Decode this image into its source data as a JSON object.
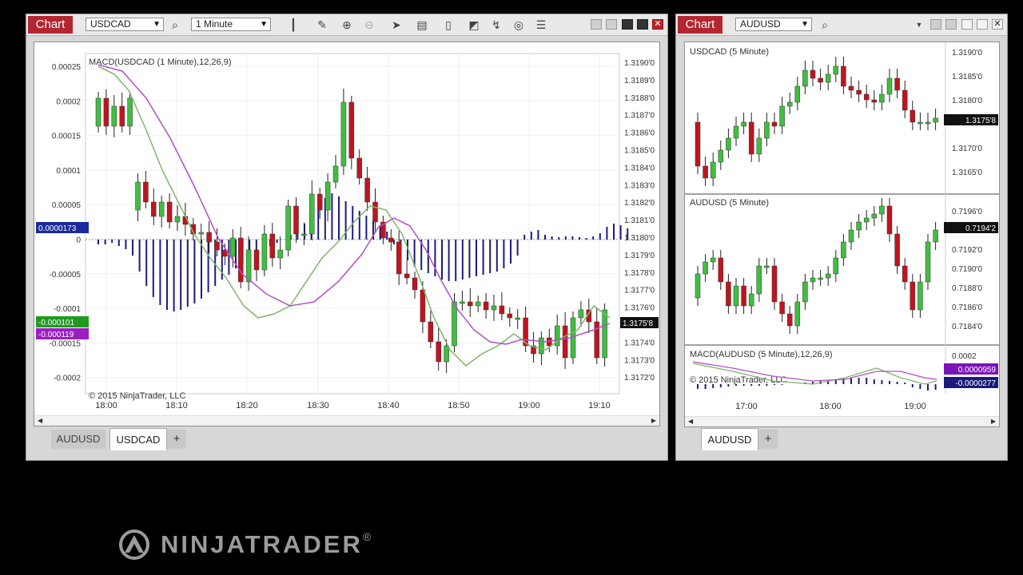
{
  "left_window": {
    "chart_tag": "Chart",
    "instrument": "USDCAD",
    "interval": "1 Minute",
    "indicator_label": "MACD(USDCAD (1 Minute),12,26,9)",
    "copyright": "© 2015 NinjaTrader, LLC",
    "left_axis_ticks": [
      "0.00025",
      "0.0002",
      "0.00015",
      "0.0001",
      "0.00005",
      "0",
      "-0.00005",
      "-0.0001",
      "-0.00015",
      "-0.0002"
    ],
    "right_axis_ticks": [
      "1.3190'0",
      "1.3189'0",
      "1.3188'0",
      "1.3187'0",
      "1.3186'0",
      "1.3185'0",
      "1.3184'0",
      "1.3183'0",
      "1.3182'0",
      "1.3181'0",
      "1.3180'0",
      "1.3179'0",
      "1.3178'0",
      "1.3177'0",
      "1.3176'0",
      "1.3175'0",
      "1.3174'0",
      "1.3173'0",
      "1.3172'0"
    ],
    "x_ticks": [
      "18:00",
      "18:10",
      "18:20",
      "18:30",
      "18:40",
      "18:50",
      "19:00",
      "19:10"
    ],
    "price_marker": "1.3175'8",
    "macd_marker_blue": "0.0000173",
    "macd_marker_green": "-0.000101",
    "macd_marker_purple": "-0.000119",
    "tabs": [
      "AUDUSD",
      "USDCAD"
    ],
    "active_tab": "USDCAD",
    "add_tab": "+"
  },
  "right_window": {
    "chart_tag": "Chart",
    "instrument": "AUDUSD",
    "panel1": {
      "label": "USDCAD (5 Minute)",
      "ticks": [
        "1.3190'0",
        "1.3185'0",
        "1.3180'0",
        "1.3170'0",
        "1.3165'0"
      ],
      "marker": "1.3175'8"
    },
    "panel2": {
      "label": "AUDUSD (5 Minute)",
      "ticks": [
        "0.7196'0",
        "0.7192'0",
        "0.7190'0",
        "0.7188'0",
        "0.7186'0",
        "0.7184'0"
      ],
      "marker": "0.7194'2"
    },
    "panel3": {
      "label": "MACD(AUDUSD (5 Minute),12,26,9)",
      "copyright": "© 2015 NinjaTrader, LLC",
      "tick": "0.0002",
      "marker_purple": "0.0000959",
      "marker_blue": "-0.0000277"
    },
    "x_ticks": [
      "17:00",
      "18:00",
      "19:00"
    ],
    "tabs": [
      "AUDUSD"
    ],
    "add_tab": "+"
  },
  "brand": {
    "name": "NINJATRADER",
    "reg": "®"
  },
  "colors": {
    "up": "#3fbf3f",
    "down": "#c1141e",
    "hist": "#1c1c7a",
    "macd_line": "#7fb56b",
    "signal_line": "#b24fc9",
    "chart_tag": "#b3262f"
  },
  "icons": [
    "search-icon",
    "bar-style-icon",
    "pencil-icon",
    "zoom-in-icon",
    "zoom-out-icon",
    "pointer-icon",
    "properties-icon",
    "strategy-icon",
    "indicators-icon",
    "refresh-icon",
    "list-icon"
  ]
}
